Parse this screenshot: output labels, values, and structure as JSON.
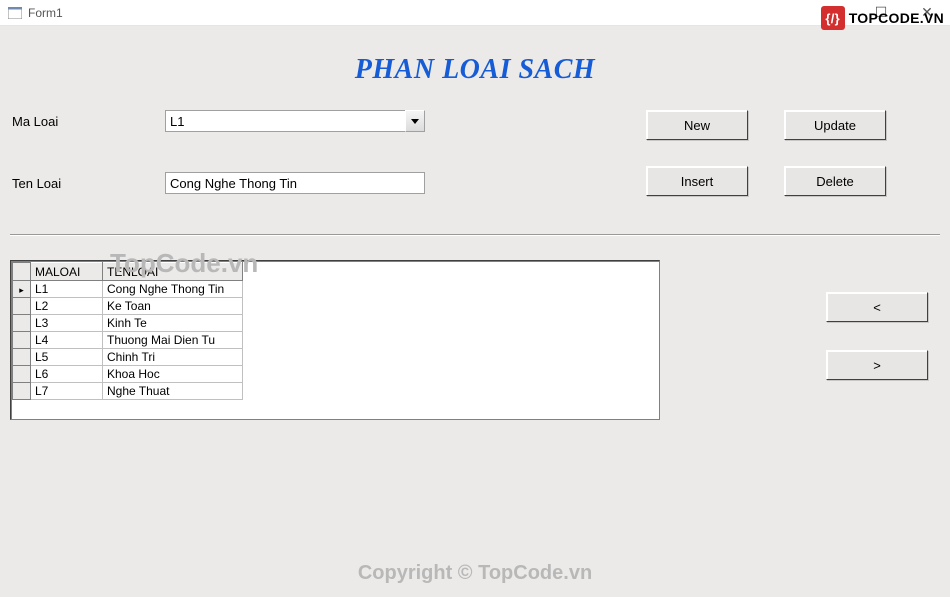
{
  "window": {
    "title": "Form1"
  },
  "watermark": {
    "brand": "TOPCODE.VN",
    "faded_text": "TopCode.vn",
    "footer": "Copyright © TopCode.vn"
  },
  "page_title": "PHAN LOAI SACH",
  "labels": {
    "ma_loai": "Ma Loai",
    "ten_loai": "Ten Loai"
  },
  "inputs": {
    "ma_loai_value": "L1",
    "ten_loai_value": "Cong Nghe Thong Tin"
  },
  "buttons": {
    "new": "New",
    "update": "Update",
    "insert": "Insert",
    "delete": "Delete",
    "prev": "<",
    "next": ">"
  },
  "grid": {
    "columns": {
      "ma": "MALOAI",
      "ten": "TENLOAI"
    },
    "rows": [
      {
        "ma": "L1",
        "ten": "Cong Nghe Thong Tin",
        "active": true
      },
      {
        "ma": "L2",
        "ten": "Ke Toan",
        "active": false
      },
      {
        "ma": "L3",
        "ten": "Kinh Te",
        "active": false
      },
      {
        "ma": "L4",
        "ten": "Thuong Mai Dien Tu",
        "active": false
      },
      {
        "ma": "L5",
        "ten": "Chinh Tri",
        "active": false
      },
      {
        "ma": "L6",
        "ten": "Khoa Hoc",
        "active": false
      },
      {
        "ma": "L7",
        "ten": "Nghe Thuat",
        "active": false
      }
    ]
  }
}
